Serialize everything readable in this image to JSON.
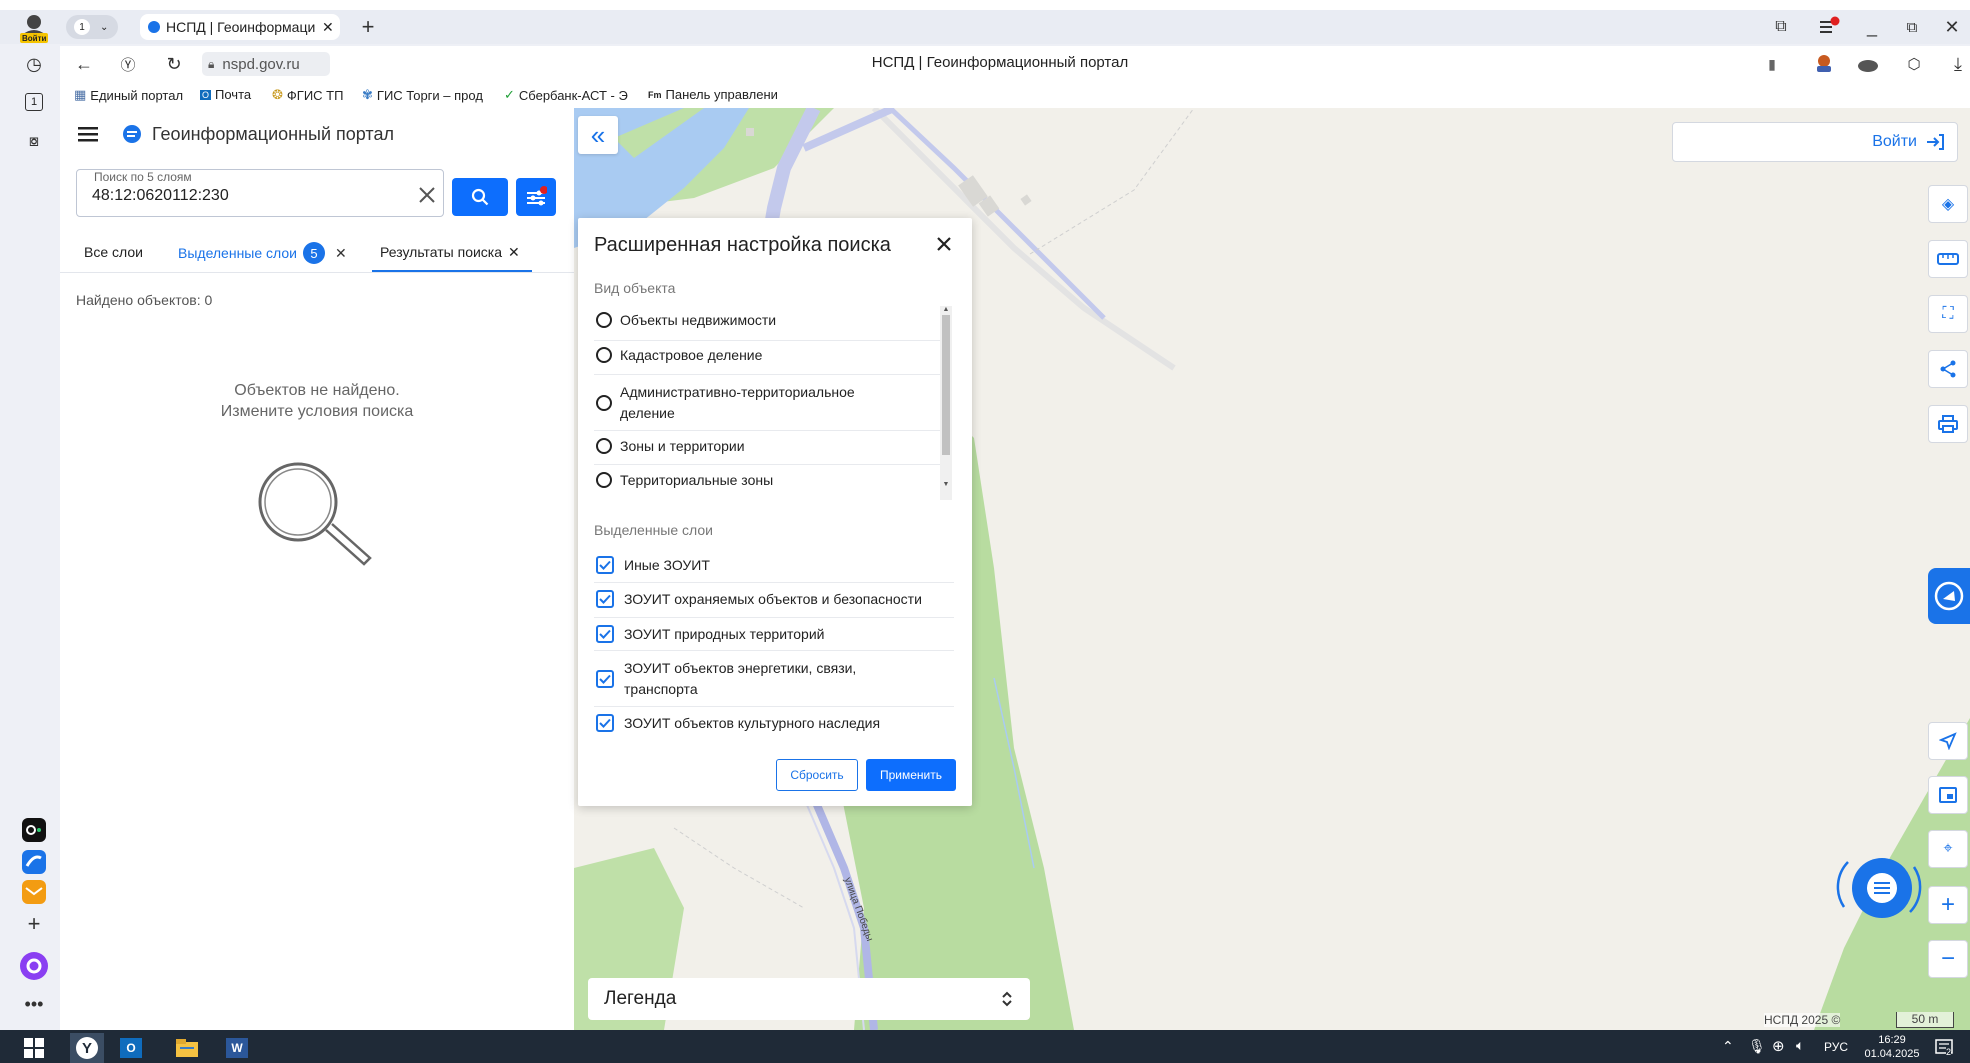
{
  "browser": {
    "tab_count": "1",
    "tab_title": "НСПД | Геоинформаци",
    "url": "nspd.gov.ru",
    "page_title": "НСПД | Геоинформационный портал",
    "bookmarks": [
      "Единый портал",
      "Почта",
      "ФГИС ТП",
      "ГИС Торги – прод",
      "Сбербанк-АСТ - Э",
      "Панель управлени"
    ],
    "profile_label": "Войти",
    "rail_counter": "1"
  },
  "app": {
    "title": "Геоинформационный портал",
    "search": {
      "label": "Поиск по 5 слоям",
      "value": "48:12:0620112:230"
    },
    "tabs": {
      "all": "Все слои",
      "selected": "Выделенные слои",
      "selected_count": "5",
      "results": "Результаты поиска"
    },
    "found_text": "Найдено объектов: 0",
    "empty_line1": "Объектов не найдено.",
    "empty_line2": "Измените условия поиска"
  },
  "dialog": {
    "title": "Расширенная настройка поиска",
    "object_type_heading": "Вид объекта",
    "object_types": [
      "Объекты недвижимости",
      "Кадастровое деление",
      "Административно-территориальное деление",
      "Зоны и территории",
      "Территориальные зоны"
    ],
    "layers_heading": "Выделенные слои",
    "layers": [
      "Иные ЗОУИТ",
      "ЗОУИТ охраняемых объектов и безопасности",
      "ЗОУИТ природных территорий",
      "ЗОУИТ объектов энергетики, связи, транспорта",
      "ЗОУИТ объектов культурного наследия"
    ],
    "reset_label": "Сбросить",
    "apply_label": "Применить"
  },
  "map": {
    "login_label": "Войти",
    "legend_label": "Легенда",
    "street_label": "улица Победы",
    "copyright": "НСПД 2025 ©",
    "scale": "50 m"
  },
  "taskbar": {
    "lang": "РУС",
    "time": "16:29",
    "date": "01.04.2025",
    "notif_count": "2"
  },
  "colors": {
    "accent": "#0d6efd",
    "map_green": "#b8dca0",
    "map_bg": "#f2f0ea"
  }
}
